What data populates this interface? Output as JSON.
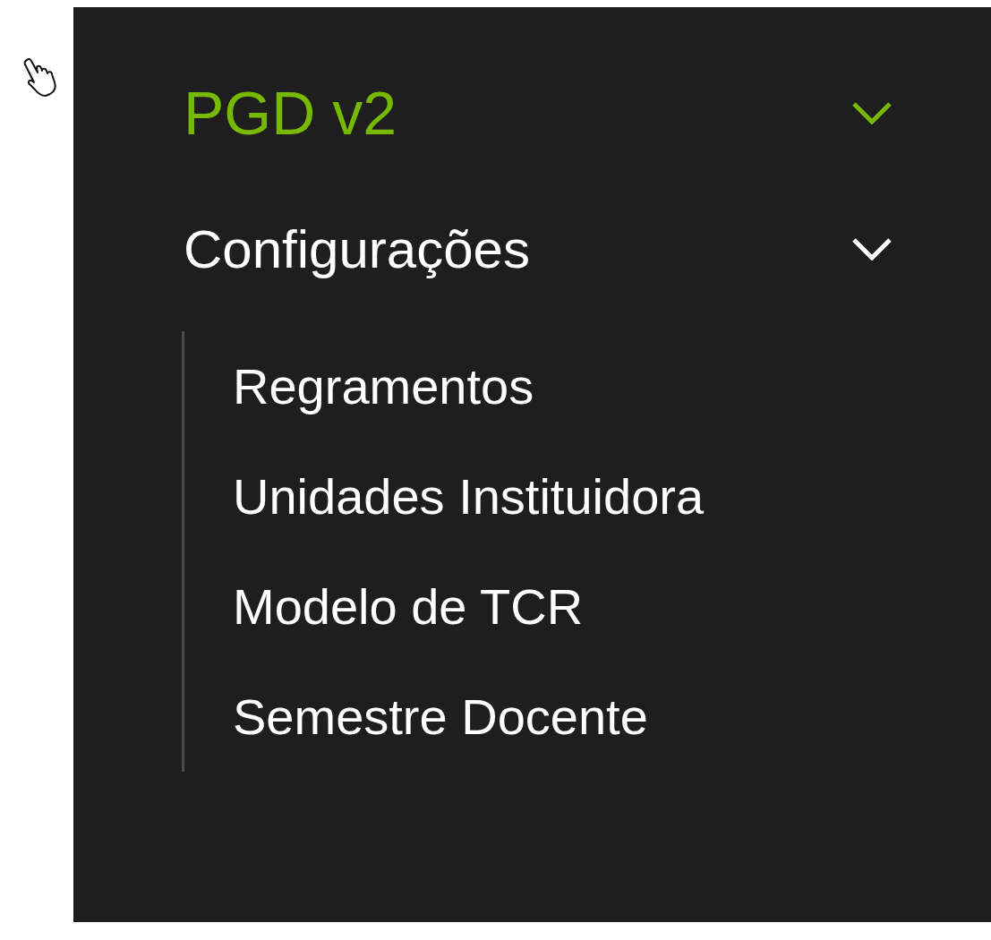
{
  "menu": [
    {
      "label": "PGD v2",
      "expanded": true,
      "selected": true,
      "children": [
        {
          "label": "Configurações",
          "expanded": true,
          "selected": false,
          "children": [
            {
              "label": "Regramentos",
              "selected": false
            },
            {
              "label": "Unidades Instituidora",
              "selected": false
            },
            {
              "label": "Modelo de TCR",
              "selected": false
            },
            {
              "label": "Semestre Docente",
              "selected": false
            }
          ]
        }
      ]
    }
  ]
}
